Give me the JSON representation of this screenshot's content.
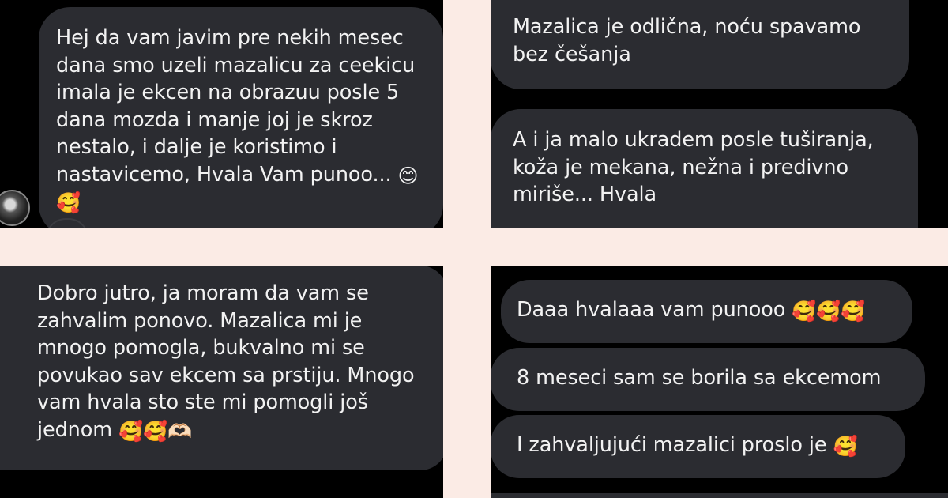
{
  "messages": {
    "m1": {
      "text": "Hej da vam javim pre nekih mesec\ndana smo uzeli mazalicu za ceekicu\nimala je ekcen na obrazuu posle 5\ndana mozda i manje joj je skroz\nnestalo, i dalje je koristimo i\nnastavicemo, Hvala Vam punoo... ",
      "emoji_end": "😊",
      "emoji_line2": "🥰"
    },
    "m2": {
      "text": "Mazalica je odlična, noću spavamo\nbez češanja"
    },
    "m3": {
      "text": "A i ja malo ukradem posle tuširanja,\nkoža je mekana, nežna i predivno\nmiriše... Hvala"
    },
    "m4": {
      "text": "Dobro jutro, ja moram da vam se\nzahvalim ponovo. Mazalica mi je\nmnogo pomogla, bukvalno mi se\npovukao sav ekcem sa prstiju. Mnogo\nvam hvala sto ste mi pomogli još\njednom ",
      "emojis": "🥰🥰🫶🏻"
    },
    "m5": {
      "text": "Daaa hvalaaa vam punooo ",
      "emojis": "🥰🥰🥰"
    },
    "m6": {
      "text": "8 meseci sam se borila sa ekcemom"
    },
    "m7": {
      "text": "I zahvaljujući mazalici proslo je ",
      "emojis": "🥰"
    }
  },
  "colors": {
    "background": "#fbebe5",
    "panel": "#000000",
    "bubble": "#2b2c31",
    "text": "#f2f2f2"
  }
}
